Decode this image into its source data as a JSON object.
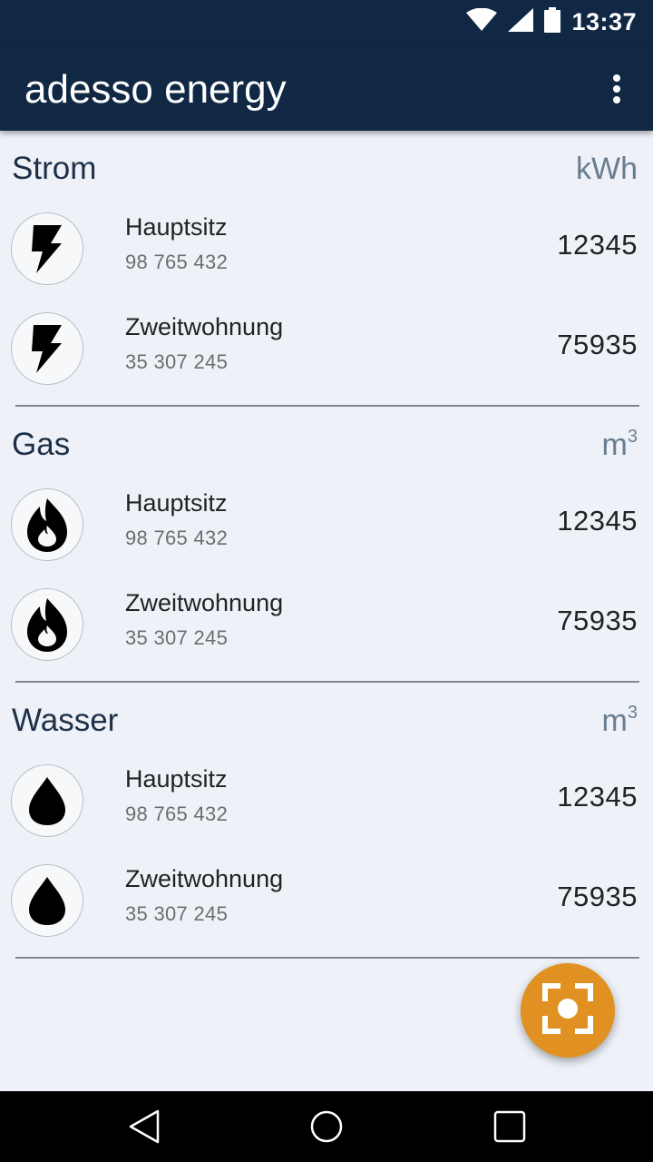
{
  "status_bar": {
    "time": "13:37",
    "icons": [
      "wifi-icon",
      "cell-signal-icon",
      "battery-icon"
    ]
  },
  "app_bar": {
    "title": "adesso energy",
    "menu_icon": "more-vert-icon"
  },
  "sections": [
    {
      "title": "Strom",
      "unit": "kWh",
      "unit_superscript": "",
      "icon": "lightning-bolt-icon",
      "meters": [
        {
          "name": "Hauptsitz",
          "number": "98 765 432",
          "value": "12345"
        },
        {
          "name": "Zweitwohnung",
          "number": "35 307 245",
          "value": "75935"
        }
      ]
    },
    {
      "title": "Gas",
      "unit": "m",
      "unit_superscript": "3",
      "icon": "flame-icon",
      "meters": [
        {
          "name": "Hauptsitz",
          "number": "98 765 432",
          "value": "12345"
        },
        {
          "name": "Zweitwohnung",
          "number": "35 307 245",
          "value": "75935"
        }
      ]
    },
    {
      "title": "Wasser",
      "unit": "m",
      "unit_superscript": "3",
      "icon": "water-drop-icon",
      "meters": [
        {
          "name": "Hauptsitz",
          "number": "98 765 432",
          "value": "12345"
        },
        {
          "name": "Zweitwohnung",
          "number": "35 307 245",
          "value": "75935"
        }
      ]
    }
  ],
  "fab": {
    "icon": "scan-camera-icon"
  },
  "nav_bar": {
    "icons": [
      "back-icon",
      "home-icon",
      "recents-icon"
    ]
  },
  "colors": {
    "primary": "#102844",
    "background": "#eef2f8",
    "accent": "#e09122"
  }
}
